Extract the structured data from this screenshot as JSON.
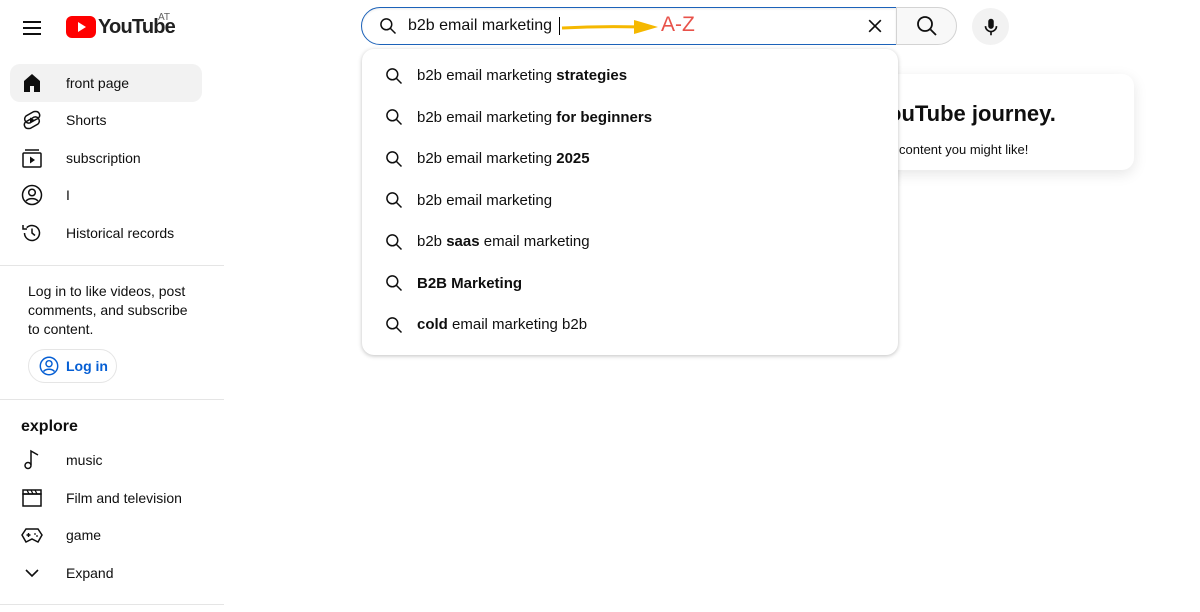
{
  "header": {
    "logo_text": "YouTube",
    "country_code": "AT",
    "search_value": "b2b email marketing",
    "annotation_label": "A-Z"
  },
  "suggestions": [
    {
      "base": "b2b email marketing ",
      "bold": "strategies",
      "suffix": ""
    },
    {
      "base": "b2b email marketing ",
      "bold": "for beginners",
      "suffix": ""
    },
    {
      "base": "b2b email marketing ",
      "bold": "2025",
      "suffix": ""
    },
    {
      "base": "b2b email marketing",
      "bold": "",
      "suffix": ""
    },
    {
      "base": "b2b ",
      "bold": "saas",
      "suffix": " email marketing"
    },
    {
      "base": "",
      "bold": "B2B Marketing",
      "suffix": ""
    },
    {
      "base": "",
      "bold": "cold",
      "suffix": " email marketing b2b"
    }
  ],
  "sidebar": {
    "items": [
      {
        "label": "front page",
        "icon": "home-icon"
      },
      {
        "label": "Shorts",
        "icon": "shorts-icon"
      },
      {
        "label": "subscription",
        "icon": "subscriptions-icon"
      },
      {
        "label": "I",
        "icon": "user-icon"
      },
      {
        "label": "Historical records",
        "icon": "history-icon"
      }
    ],
    "login_prompt": "Log in to like videos, post comments, and subscribe to content.",
    "login_label": "Log in",
    "explore_title": "explore",
    "explore_items": [
      {
        "label": "music",
        "icon": "music-note-icon"
      },
      {
        "label": "Film and television",
        "icon": "film-icon"
      },
      {
        "label": "game",
        "icon": "gamepad-icon"
      },
      {
        "label": "Expand",
        "icon": "chevron-down-icon"
      }
    ]
  },
  "main": {
    "journey_title": "ouTube journey.",
    "journey_subtitle": "content you might like!"
  },
  "colors": {
    "brand_red": "#ff0000",
    "focus_blue": "#1c62b9",
    "link_blue": "#065fd4",
    "annotation_red": "#e8524a",
    "annotation_arrow": "#f5b800"
  }
}
